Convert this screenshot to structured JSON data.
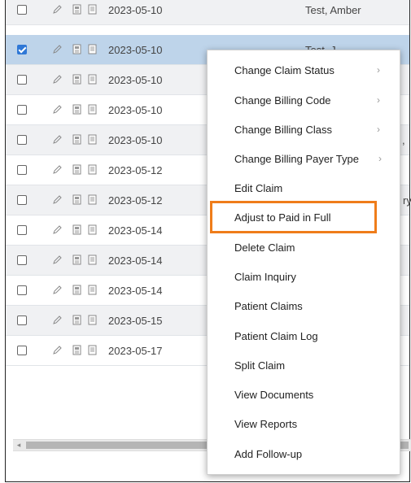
{
  "rows": [
    {
      "date": "2023-05-10",
      "patient": "Test, Amber",
      "checked": false
    },
    {
      "date": "2023-05-10",
      "patient": "Test, J...",
      "checked": true
    },
    {
      "date": "2023-05-10",
      "patient": "",
      "checked": false
    },
    {
      "date": "2023-05-10",
      "patient": "",
      "checked": false
    },
    {
      "date": "2023-05-10",
      "patient": "",
      "checked": false
    },
    {
      "date": "2023-05-12",
      "patient": "",
      "checked": false
    },
    {
      "date": "2023-05-12",
      "patient": "",
      "checked": false
    },
    {
      "date": "2023-05-14",
      "patient": "",
      "checked": false
    },
    {
      "date": "2023-05-14",
      "patient": "",
      "checked": false
    },
    {
      "date": "2023-05-14",
      "patient": "",
      "checked": false
    },
    {
      "date": "2023-05-15",
      "patient": "",
      "checked": false
    },
    {
      "date": "2023-05-17",
      "patient": "",
      "checked": false
    }
  ],
  "row_icons": [
    "edit-icon",
    "document-icon",
    "notes-icon"
  ],
  "context_menu": {
    "items": [
      {
        "label": "Change Claim Status",
        "submenu": true
      },
      {
        "label": "Change Billing Code",
        "submenu": true
      },
      {
        "label": "Change Billing Class",
        "submenu": true
      },
      {
        "label": "Change Billing Payer Type",
        "submenu": true
      },
      {
        "label": "Edit Claim",
        "submenu": false
      },
      {
        "label": "Adjust to Paid in Full",
        "submenu": false,
        "highlighted": true
      },
      {
        "label": "Delete Claim",
        "submenu": false
      },
      {
        "label": "Claim Inquiry",
        "submenu": false
      },
      {
        "label": "Patient Claims",
        "submenu": false
      },
      {
        "label": "Patient Claim Log",
        "submenu": false
      },
      {
        "label": "Split Claim",
        "submenu": false
      },
      {
        "label": "View Documents",
        "submenu": false
      },
      {
        "label": "View Reports",
        "submenu": false
      },
      {
        "label": "Add Follow-up",
        "submenu": false
      }
    ],
    "chevron": "›"
  },
  "edge_text": {
    "row4": ",",
    "row6": "ry"
  },
  "colors": {
    "highlight": "#ef7d1a",
    "selected_row": "#bed4ea",
    "checkbox": "#2f78d6"
  }
}
